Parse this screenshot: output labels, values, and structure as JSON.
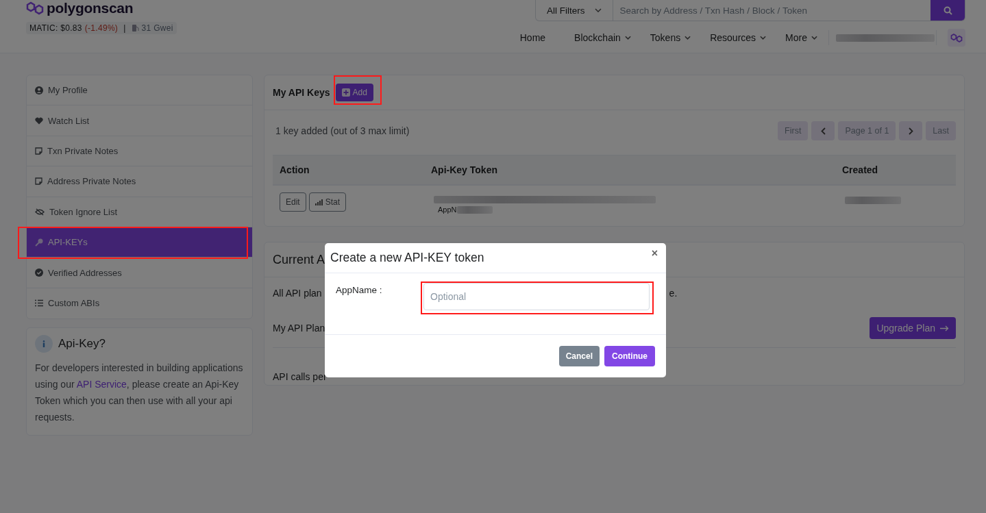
{
  "header": {
    "logo": "polygonscan",
    "price": {
      "label": "MATIC: $0.83",
      "change": "(-1.49%)",
      "separator": "|",
      "gas": "31 Gwei"
    },
    "search": {
      "filter": "All Filters",
      "placeholder": "Search by Address / Txn Hash / Block / Token"
    },
    "nav": [
      {
        "label": "Home",
        "dropdown": false
      },
      {
        "label": "Blockchain",
        "dropdown": true
      },
      {
        "label": "Tokens",
        "dropdown": true
      },
      {
        "label": "Resources",
        "dropdown": true
      },
      {
        "label": "More",
        "dropdown": true
      }
    ]
  },
  "sidebar": {
    "items": [
      {
        "label": "My Profile",
        "kind": "profile",
        "selected": false
      },
      {
        "label": "Watch List",
        "kind": "heart",
        "selected": false
      },
      {
        "label": "Txn Private Notes",
        "kind": "note",
        "selected": false
      },
      {
        "label": "Address Private Notes",
        "kind": "note",
        "selected": false
      },
      {
        "label": "Token Ignore List",
        "kind": "eye-slash",
        "selected": false
      },
      {
        "label": "API-KEYs",
        "kind": "key",
        "selected": true
      },
      {
        "label": "Verified Addresses",
        "kind": "badge",
        "selected": false
      },
      {
        "label": "Custom ABIs",
        "kind": "list",
        "selected": false
      }
    ]
  },
  "info_card": {
    "title": "Api-Key?",
    "text_before": "For developers interested in building applications using our",
    "link": "API Service",
    "text_after": ", please create an Api-Key Token which you can then use with all your api requests."
  },
  "keys_panel": {
    "title": "My API Keys",
    "add_button": "Add",
    "count": "1 key added (out of 3 max limit)",
    "pagination": {
      "first": "First",
      "page": "Page 1 of 1",
      "last": "Last"
    },
    "table": {
      "columns": [
        "Action",
        "Api-Key Token",
        "Created"
      ],
      "rows": [
        {
          "buttons": [
            "Edit",
            "Stat"
          ],
          "app_name": "AppN"
        }
      ]
    }
  },
  "plan_panel": {
    "title": "Current A",
    "note_start": "All API plan",
    "note_end": "e.",
    "plan_label": "My API Plan",
    "upgrade_button": "Upgrade Plan",
    "rate_label": "API calls per"
  },
  "modal": {
    "title": "Create a new API-KEY token",
    "close": "×",
    "field_label": "AppName :",
    "placeholder": "Optional",
    "buttons": [
      {
        "label": "Cancel",
        "kind": "secondary"
      },
      {
        "label": "Continue",
        "kind": "primary"
      }
    ]
  }
}
